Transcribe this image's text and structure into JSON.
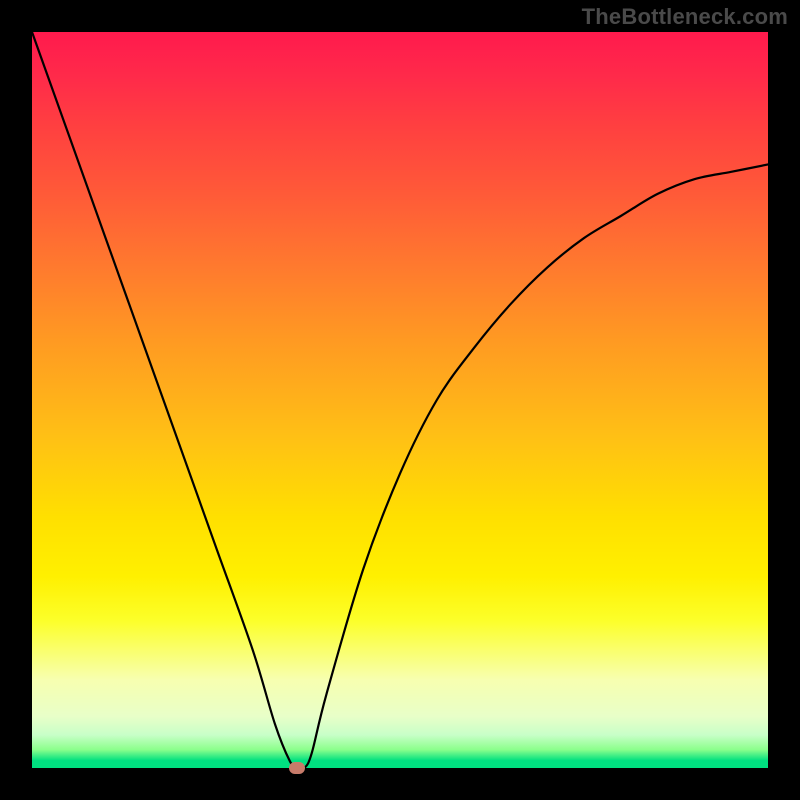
{
  "watermark": "TheBottleneck.com",
  "colors": {
    "frame": "#000000",
    "curve": "#000000",
    "marker": "#c77b6a"
  },
  "chart_data": {
    "type": "line",
    "title": "",
    "xlabel": "",
    "ylabel": "",
    "xlim": [
      0,
      100
    ],
    "ylim": [
      0,
      100
    ],
    "grid": false,
    "series": [
      {
        "name": "bottleneck-curve",
        "x": [
          0,
          5,
          10,
          15,
          20,
          25,
          30,
          33,
          35,
          36,
          37,
          38,
          40,
          45,
          50,
          55,
          60,
          65,
          70,
          75,
          80,
          85,
          90,
          95,
          100
        ],
        "values": [
          100,
          86,
          72,
          58,
          44,
          30,
          16,
          6,
          1,
          0,
          0,
          2,
          10,
          27,
          40,
          50,
          57,
          63,
          68,
          72,
          75,
          78,
          80,
          81,
          82
        ]
      }
    ],
    "annotations": [
      {
        "name": "optimal-point",
        "x": 36,
        "y": 0
      }
    ]
  }
}
